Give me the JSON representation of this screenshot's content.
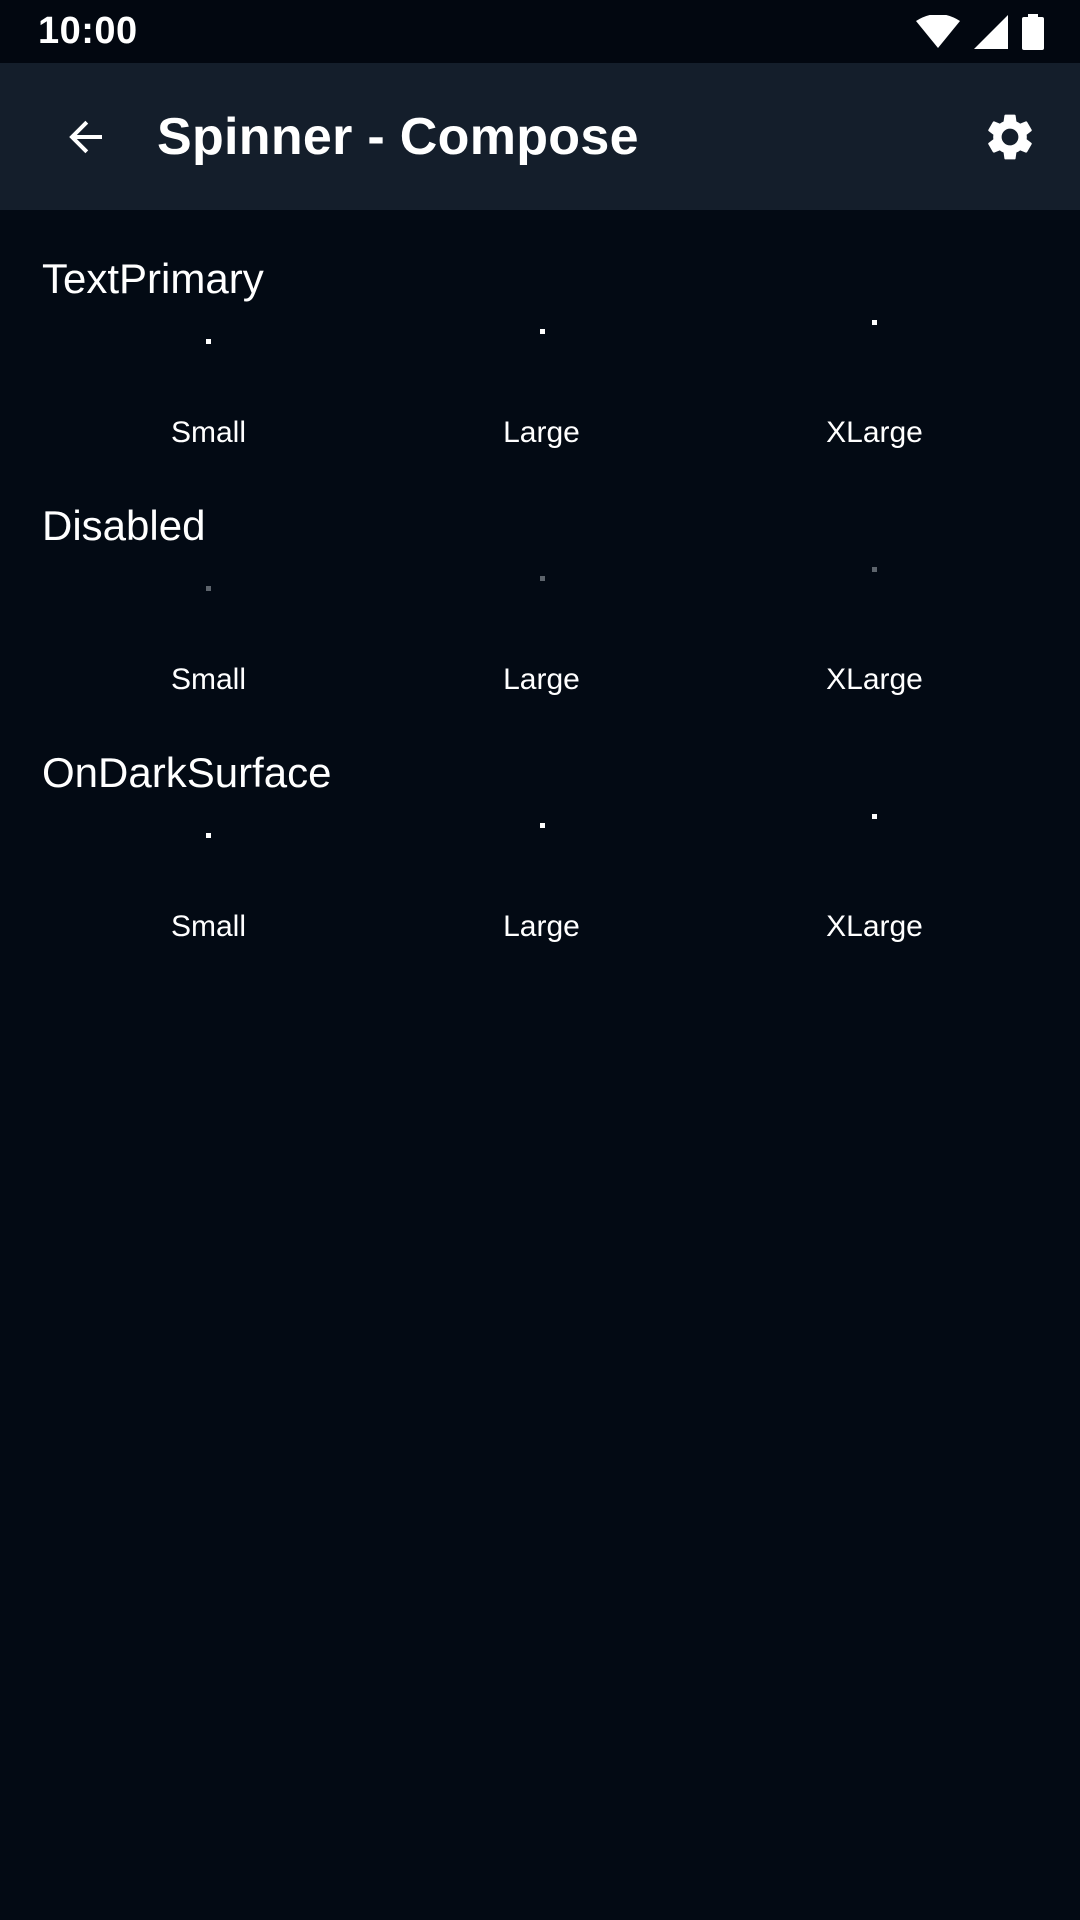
{
  "status_bar": {
    "time": "10:00",
    "icons": [
      "wifi-icon",
      "signal-icon",
      "battery-icon"
    ]
  },
  "app_bar": {
    "back_icon": "arrow-back-icon",
    "title": "Spinner - Compose",
    "settings_icon": "gear-icon"
  },
  "colors": {
    "background": "#030a14",
    "app_bar": "#141e2b",
    "status_bar": "#020710",
    "spinner": "#ffffff",
    "spinner_disabled": "#5d646c"
  },
  "sections": [
    {
      "title": "TextPrimary",
      "spinners": [
        {
          "label": "Small"
        },
        {
          "label": "Large"
        },
        {
          "label": "XLarge"
        }
      ]
    },
    {
      "title": "Disabled",
      "spinners": [
        {
          "label": "Small"
        },
        {
          "label": "Large"
        },
        {
          "label": "XLarge"
        }
      ]
    },
    {
      "title": "OnDarkSurface",
      "spinners": [
        {
          "label": "Small"
        },
        {
          "label": "Large"
        },
        {
          "label": "XLarge"
        }
      ]
    }
  ]
}
